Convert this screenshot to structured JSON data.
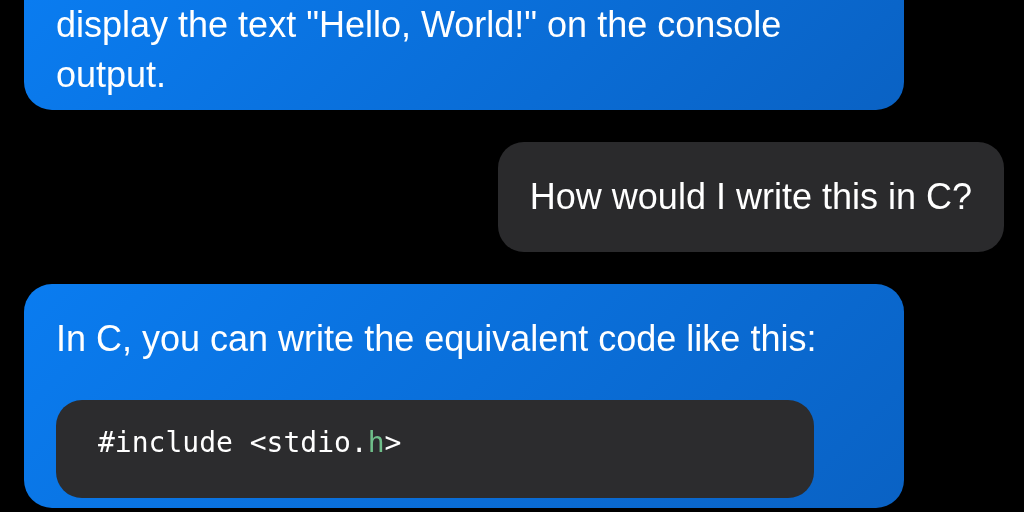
{
  "messages": [
    {
      "kind": "assistant",
      "paragraphs": [
        "display the text \"Hello, World!\" on the console output."
      ]
    },
    {
      "kind": "user",
      "paragraphs": [
        "How would I write this in C?"
      ]
    },
    {
      "kind": "assistant",
      "paragraphs": [
        "In C, you can write the equivalent code like this:"
      ],
      "code": [
        [
          {
            "text": "#include <stdio.",
            "kind": "plain"
          },
          {
            "text": "h",
            "kind": "identifier"
          },
          {
            "text": ">",
            "kind": "plain"
          }
        ]
      ]
    }
  ]
}
